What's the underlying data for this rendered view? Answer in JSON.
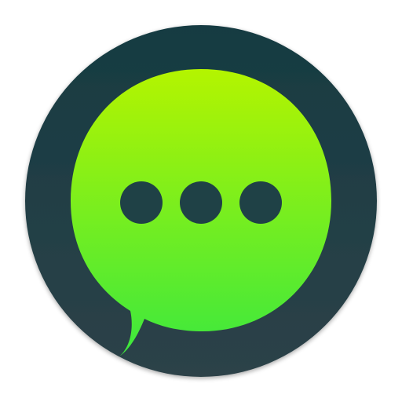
{
  "icon": {
    "name": "chat-bubble-app-icon",
    "colors": {
      "background": "#ffffff",
      "ring_top": "#163b42",
      "ring_bottom": "#2d4248",
      "bubble_top": "#b4f400",
      "bubble_bottom": "#3ce83e",
      "dots": "#1f4146"
    },
    "dots_count": 3
  }
}
